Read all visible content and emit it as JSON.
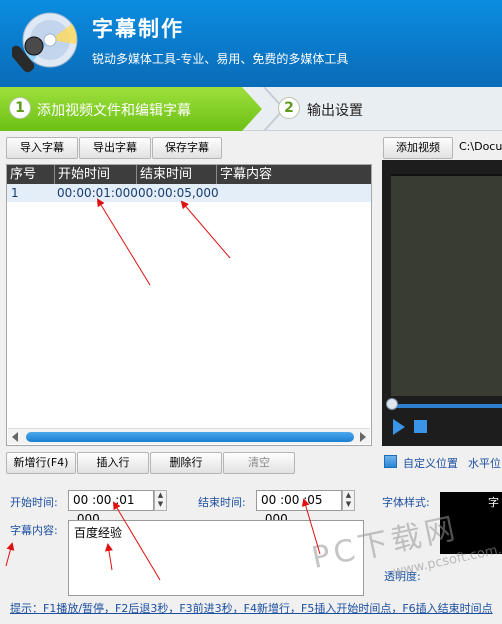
{
  "header": {
    "title": "字幕制作",
    "subtitle": "锐动多媒体工具-专业、易用、免费的多媒体工具"
  },
  "steps": [
    {
      "num": "1",
      "label": "添加视频文件和编辑字幕"
    },
    {
      "num": "2",
      "label": "输出设置"
    }
  ],
  "toolbar": {
    "import": "导入字幕",
    "export": "导出字幕",
    "save": "保存字幕"
  },
  "video": {
    "add_button": "添加视频",
    "path": "C:\\Docum"
  },
  "table": {
    "columns": [
      "序号",
      "开始时间",
      "结束时间",
      "字幕内容"
    ],
    "rows": [
      {
        "index": "1",
        "start": "00:00:01:000",
        "end": "00:00:05,000",
        "content": ""
      }
    ]
  },
  "row_actions": {
    "new_row": "新增行(F4)",
    "insert": "插入行",
    "delete": "删除行",
    "clear": "清空"
  },
  "options": {
    "custom_position": "自定义位置",
    "horizontal": "水平位"
  },
  "form": {
    "start_label": "开始时间:",
    "start_value": "00 :00 :01 ,000",
    "end_label": "结束时间:",
    "end_value": "00 :00 :05 ,000",
    "font_style_label": "字体样式:",
    "content_label": "字幕内容:",
    "content_value": "百度经验",
    "opacity_label": "透明度:",
    "preview_char": "字"
  },
  "hint": "提示：F1播放/暂停，F2后退3秒，F3前进3秒，F4新增行，F5插入开始时间点，F6插入结束时间点",
  "watermark": {
    "text": "PC下载网",
    "url": "www.pcsoft.com.cn"
  },
  "colors": {
    "header_blue": "#0a78c8",
    "step_green": "#6cc016",
    "annotation_red": "#e01010",
    "link_blue": "#1c4fa0"
  },
  "icons": [
    "cd-microphone-logo-icon",
    "play-icon",
    "stop-icon",
    "spin-up-icon",
    "spin-down-icon",
    "scroll-left-icon",
    "scroll-right-icon"
  ]
}
